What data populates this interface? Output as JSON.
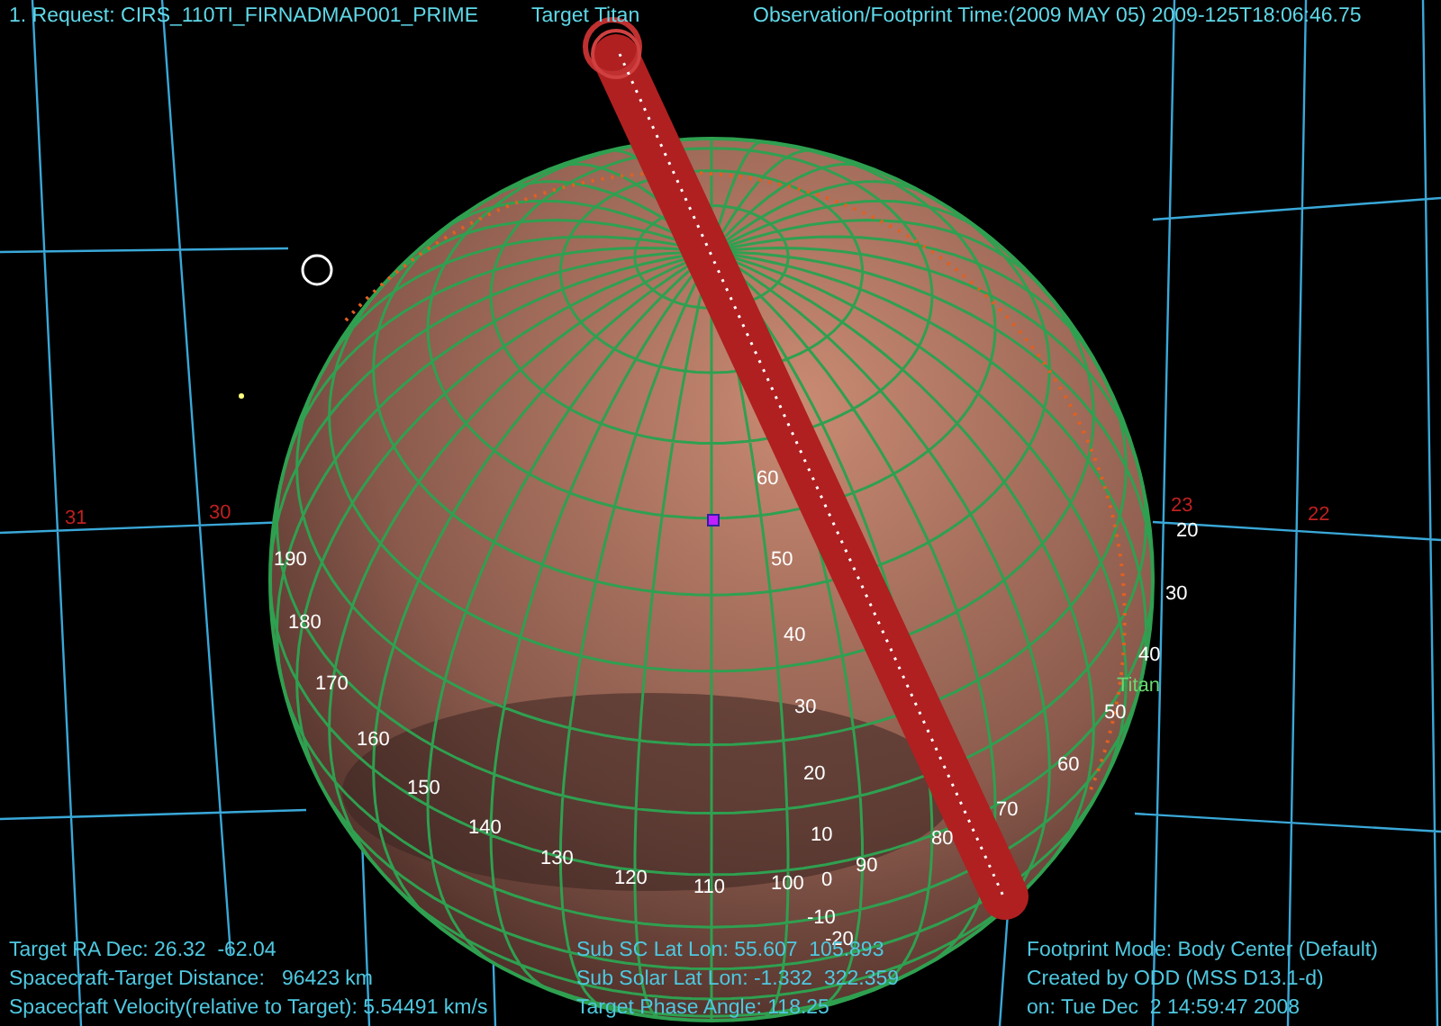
{
  "header": [
    {
      "text": "1. Request: CIRS_110TI_FIRNADMAP001_PRIME"
    },
    {
      "text": "Target Titan"
    },
    {
      "text": "Observation/Footprint Time:(2009 MAY 05) 2009-125T18:06:46.75"
    }
  ],
  "sky_labels": [
    "31",
    "30",
    "23",
    "22"
  ],
  "longitude_labels": [
    "190",
    "180",
    "170",
    "160",
    "150",
    "140",
    "130",
    "120",
    "110",
    "100",
    "90",
    "80",
    "70",
    "60",
    "50",
    "40",
    "30",
    "20"
  ],
  "latitude_labels": [
    "60",
    "50",
    "40",
    "30",
    "20",
    "10",
    "0",
    "-10",
    "-20"
  ],
  "body_label": "Titan",
  "info_panel": {
    "left": [
      "Target RA Dec: 26.32  -62.04",
      "Spacecraft-Target Distance:   96423 km",
      "Spacecraft Velocity(relative to Target): 5.54491 km/s"
    ],
    "middle": [
      "Sub SC Lat Lon: 55.607  105.893",
      "Sub Solar Lat Lon: -1.332  322.359",
      "Target Phase Angle: 118.25"
    ],
    "right": [
      "Footprint Mode: Body Center (Default)",
      "Created by ODD (MSS D13.1-d)",
      "on: Tue Dec  2 14:59:47 2008"
    ]
  }
}
